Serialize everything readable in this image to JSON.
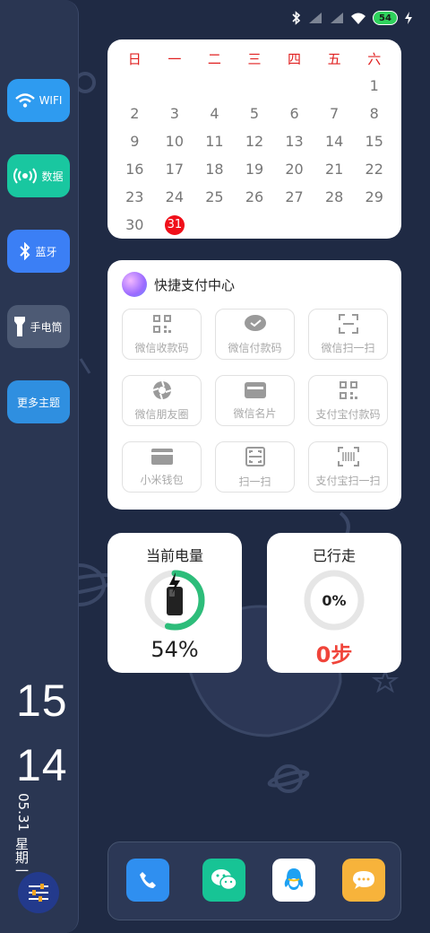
{
  "status_bar": {
    "battery": "54"
  },
  "quick_settings": [
    {
      "label": "WIFI",
      "color": "#2e9bf0",
      "icon": "wifi-icon"
    },
    {
      "label": "数据",
      "color": "#19c7a0",
      "icon": "signal-broadcast-icon"
    },
    {
      "label": "蓝牙",
      "color": "#3b7ff5",
      "icon": "bluetooth-icon"
    },
    {
      "label": "手电筒",
      "color": "#4d5a74",
      "icon": "flashlight-icon"
    },
    {
      "label": "更多主题",
      "color": "#2f8fe0",
      "icon": ""
    }
  ],
  "clock": {
    "hour": "15",
    "minute": "14",
    "date": "05.31",
    "weekday": "星期一"
  },
  "calendar": {
    "weekdays": [
      "日",
      "一",
      "二",
      "三",
      "四",
      "五",
      "六"
    ],
    "weeks": [
      [
        "",
        "",
        "",
        "",
        "",
        "",
        "1"
      ],
      [
        "2",
        "3",
        "4",
        "5",
        "6",
        "7",
        "8"
      ],
      [
        "9",
        "10",
        "11",
        "12",
        "13",
        "14",
        "15"
      ],
      [
        "16",
        "17",
        "18",
        "19",
        "20",
        "21",
        "22"
      ],
      [
        "23",
        "24",
        "25",
        "26",
        "27",
        "28",
        "29"
      ],
      [
        "30",
        "31",
        "",
        "",
        "",
        "",
        ""
      ]
    ],
    "today": "31",
    "accent": "#e02020"
  },
  "pay_center": {
    "title": "快捷支付中心",
    "tiles": [
      {
        "label": "微信收款码",
        "icon": "qr-code-icon"
      },
      {
        "label": "微信付款码",
        "icon": "wechat-pay-icon"
      },
      {
        "label": "微信扫一扫",
        "icon": "scan-frame-icon"
      },
      {
        "label": "微信朋友圈",
        "icon": "moments-aperture-icon"
      },
      {
        "label": "微信名片",
        "icon": "card-icon"
      },
      {
        "label": "支付宝付款码",
        "icon": "qr-code-icon"
      },
      {
        "label": "小米钱包",
        "icon": "wallet-icon"
      },
      {
        "label": "扫一扫",
        "icon": "scan-icon"
      },
      {
        "label": "支付宝扫一扫",
        "icon": "barcode-scan-icon"
      }
    ]
  },
  "battery_widget": {
    "title": "当前电量",
    "value": "54%",
    "level": 0.54,
    "ring_color": "#2dbd7a"
  },
  "steps_widget": {
    "title": "已行走",
    "percent": "0%",
    "steps": "0步",
    "steps_color": "#f0443a"
  },
  "dock": [
    {
      "name": "phone",
      "color": "#2f8ff0",
      "icon": "phone-icon"
    },
    {
      "name": "wechat",
      "color": "#17c495",
      "icon": "wechat-icon"
    },
    {
      "name": "qq",
      "color": "#ffffff",
      "icon": "qq-penguin-icon"
    },
    {
      "name": "messages",
      "color": "#f7b33b",
      "icon": "message-icon"
    }
  ]
}
